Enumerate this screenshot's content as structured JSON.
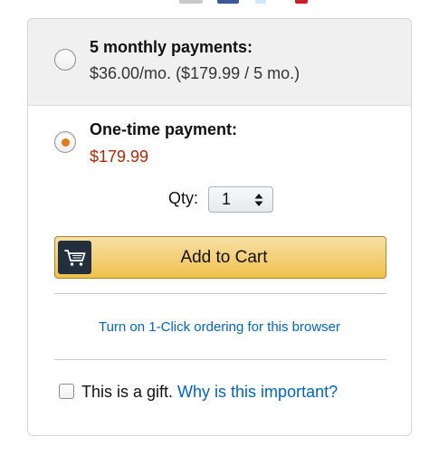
{
  "share_icons": [
    "email-icon",
    "facebook-icon",
    "twitter-icon",
    "pinterest-icon"
  ],
  "purchase_options": {
    "monthly": {
      "title": "5 monthly payments:",
      "detail": "$36.00/mo. ($179.99 / 5 mo.)",
      "selected": false
    },
    "one_time": {
      "title": "One-time payment:",
      "price": "$179.99",
      "selected": true
    }
  },
  "quantity": {
    "label": "Qty:",
    "value": "1"
  },
  "add_to_cart": {
    "label": "Add to Cart",
    "icon": "cart-icon"
  },
  "one_click": {
    "link_text": "Turn on 1-Click ordering for this browser"
  },
  "gift": {
    "label": "This is a gift.",
    "link_text": "Why is this important?",
    "checked": false
  },
  "colors": {
    "price": "#b12704",
    "link": "#0066c0",
    "radio_selected": "#e47911",
    "button_top": "#f7dfa5",
    "button_bottom": "#f0c14b",
    "cart_icon_bg": "#232f3e"
  }
}
